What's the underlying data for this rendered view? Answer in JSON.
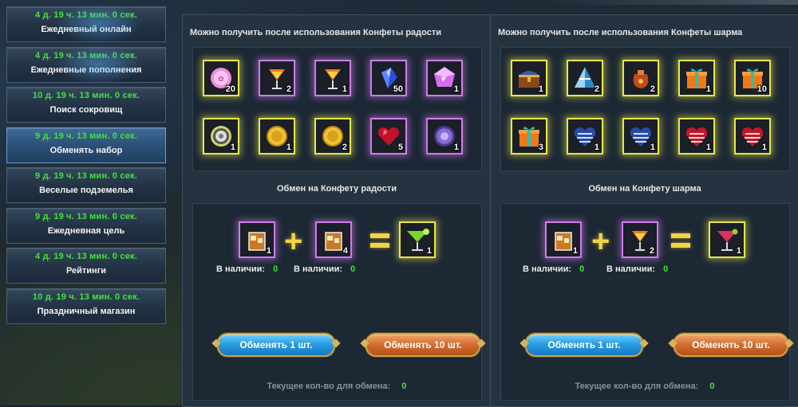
{
  "sidebar": {
    "items": [
      {
        "timer": "4 д. 19 ч. 13 мин. 0 сек.",
        "label": "Ежедневный онлайн"
      },
      {
        "timer": "4 д. 19 ч. 13 мин. 0 сек.",
        "label": "Ежедневные пополнения"
      },
      {
        "timer": "10 д. 19 ч. 13 мин. 0 сек.",
        "label": "Поиск сокровищ"
      },
      {
        "timer": "9 д. 19 ч. 13 мин. 0 сек.",
        "label": "Обменять набор"
      },
      {
        "timer": "9 д. 19 ч. 13 мин. 0 сек.",
        "label": "Веселые подземелья"
      },
      {
        "timer": "9 д. 19 ч. 13 мин. 0 сек.",
        "label": "Ежедневная цель"
      },
      {
        "timer": "4 д. 19 ч. 13 мин. 0 сек.",
        "label": "Рейтинги"
      },
      {
        "timer": "10 д. 19 ч. 13 мин. 0 сек.",
        "label": "Праздничный магазин"
      }
    ],
    "active_index": 3
  },
  "joy": {
    "title": "Можно получить после использования Конфеты радости",
    "rewards": [
      {
        "icon": "pink-orb-icon",
        "count": "20",
        "frame": "gold"
      },
      {
        "icon": "orange-cocktail-icon",
        "count": "2",
        "frame": "purple"
      },
      {
        "icon": "orange-cocktail-icon",
        "count": "1",
        "frame": "purple"
      },
      {
        "icon": "blue-crystal-icon",
        "count": "50",
        "frame": "purple"
      },
      {
        "icon": "purple-gem-icon",
        "count": "1",
        "frame": "purple"
      },
      {
        "icon": "silver-coin-icon",
        "count": "1",
        "frame": "gold"
      },
      {
        "icon": "gold-coin-icon",
        "count": "1",
        "frame": "gold"
      },
      {
        "icon": "gold-coin-icon",
        "count": "2",
        "frame": "gold"
      },
      {
        "icon": "red-heart-gem-icon",
        "count": "5",
        "frame": "purple"
      },
      {
        "icon": "purple-medal-icon",
        "count": "1",
        "frame": "purple"
      }
    ],
    "exchange_title": "Обмен на Конфету радости",
    "ingredient1": {
      "icon": "whiskey-glass-icon",
      "count": "1"
    },
    "ingredient2": {
      "icon": "whiskey-glass-icon",
      "count": "4"
    },
    "result": {
      "icon": "green-margarita-icon",
      "count": "1"
    },
    "avail_label": "В наличии:",
    "avail1": "0",
    "avail2": "0",
    "btn1": "Обменять 1 шт.",
    "btn10": "Обменять 10 шт.",
    "current_label": "Текущее кол-во для обмена:",
    "current_value": "0"
  },
  "charm": {
    "title": "Можно получить после использования Конфеты шарма",
    "rewards": [
      {
        "icon": "treasure-chest-icon",
        "count": "1",
        "frame": "gold"
      },
      {
        "icon": "blue-pyramid-box-icon",
        "count": "2",
        "frame": "gold"
      },
      {
        "icon": "red-sack-icon",
        "count": "2",
        "frame": "gold"
      },
      {
        "icon": "orange-gift-icon",
        "count": "1",
        "frame": "gold"
      },
      {
        "icon": "orange-gift-icon",
        "count": "10",
        "frame": "gold"
      },
      {
        "icon": "orange-gift-icon",
        "count": "3",
        "frame": "gold"
      },
      {
        "icon": "blue-heart-box-icon",
        "count": "1",
        "frame": "gold"
      },
      {
        "icon": "blue-heart-box-icon",
        "count": "1",
        "frame": "gold"
      },
      {
        "icon": "red-heart-box-icon",
        "count": "1",
        "frame": "gold"
      },
      {
        "icon": "red-heart-box-icon",
        "count": "1",
        "frame": "gold"
      }
    ],
    "exchange_title": "Обмен на Конфету шарма",
    "ingredient1": {
      "icon": "whiskey-glass-icon",
      "count": "1"
    },
    "ingredient2": {
      "icon": "orange-cocktail-icon",
      "count": "2"
    },
    "result": {
      "icon": "red-cosmo-icon",
      "count": "1"
    },
    "avail_label": "В наличии:",
    "avail1": "0",
    "avail2": "0",
    "btn1": "Обменять 1 шт.",
    "btn10": "Обменять 10 шт.",
    "current_label": "Текущее кол-во для обмена:",
    "current_value": "0"
  },
  "colors": {
    "timer_green": "#41e33a",
    "gold_frame": "#e8e64a",
    "purple_frame": "#cf7bea",
    "plus_yellow": "#f2d544"
  }
}
